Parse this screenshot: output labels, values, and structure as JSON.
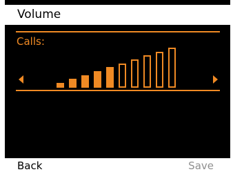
{
  "colors": {
    "accent": "#f08a24",
    "background": "#000000",
    "bar_fill": "#ffffff",
    "softkey_disabled": "#8f8f8f"
  },
  "header": {
    "title": "Volume"
  },
  "setting": {
    "label": "Calls:",
    "left_arrow_icon": "triangle-left-icon",
    "right_arrow_icon": "triangle-right-icon"
  },
  "volume": {
    "level": 5,
    "max_level": 10
  },
  "softkeys": {
    "left_label": "Back",
    "right_label": "Save"
  }
}
